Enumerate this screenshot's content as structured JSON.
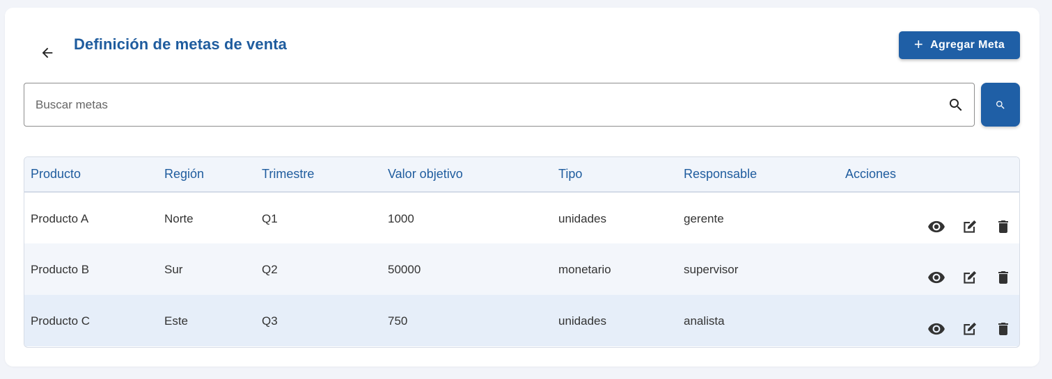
{
  "header": {
    "title": "Definición de metas de venta",
    "back_icon": "arrow-left-icon",
    "add_button_label": "Agregar Meta",
    "add_button_icon": "plus-icon"
  },
  "search": {
    "placeholder": "Buscar metas",
    "value": "",
    "icon": "search-icon"
  },
  "table": {
    "columns": [
      "Producto",
      "Región",
      "Trimestre",
      "Valor objetivo",
      "Tipo",
      "Responsable",
      "Acciones"
    ],
    "rows": [
      {
        "producto": "Producto A",
        "region": "Norte",
        "trimestre": "Q1",
        "valor": "1000",
        "tipo": "unidades",
        "responsable": "gerente"
      },
      {
        "producto": "Producto B",
        "region": "Sur",
        "trimestre": "Q2",
        "valor": "50000",
        "tipo": "monetario",
        "responsable": "supervisor"
      },
      {
        "producto": "Producto C",
        "region": "Este",
        "trimestre": "Q3",
        "valor": "750",
        "tipo": "unidades",
        "responsable": "analista"
      }
    ],
    "row_actions": [
      "eye-icon",
      "edit-icon",
      "trash-icon"
    ]
  },
  "colors": {
    "accent": "#1f5fa6",
    "title": "#1f5c9e",
    "header_bg": "#f1f5fb",
    "row_alt": "#f3f6fb",
    "row_highlight": "#e6eef9"
  }
}
